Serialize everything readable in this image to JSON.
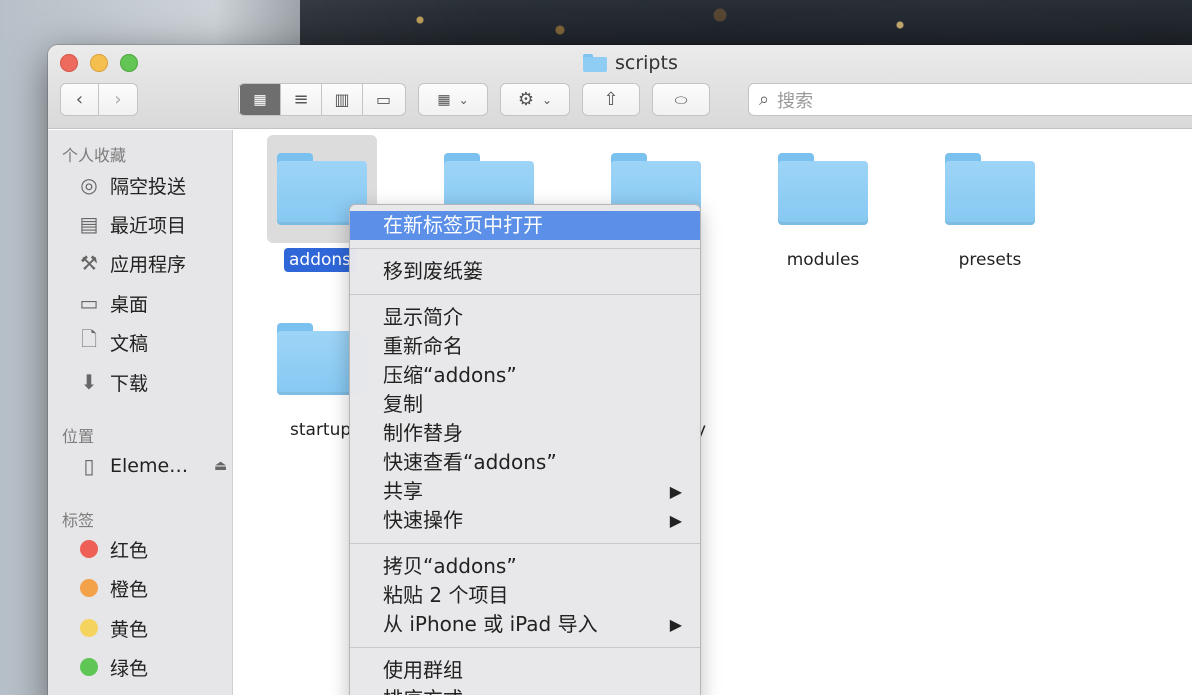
{
  "window": {
    "title": "scripts"
  },
  "toolbar": {
    "back_icon": "chevron-left-icon",
    "forward_icon": "chevron-right-icon",
    "view_buttons": [
      "icon-view",
      "list-view",
      "column-view",
      "gallery-view"
    ],
    "search_placeholder": "搜索"
  },
  "sidebar": {
    "favorites_header": "个人收藏",
    "favorites": [
      {
        "label": "隔空投送",
        "icon": "airdrop-icon"
      },
      {
        "label": "最近项目",
        "icon": "recents-icon"
      },
      {
        "label": "应用程序",
        "icon": "applications-icon"
      },
      {
        "label": "桌面",
        "icon": "desktop-icon"
      },
      {
        "label": "文稿",
        "icon": "documents-icon"
      },
      {
        "label": "下载",
        "icon": "downloads-icon"
      }
    ],
    "locations_header": "位置",
    "locations": [
      {
        "label": "Eleme…",
        "icon": "drive-icon"
      }
    ],
    "tags_header": "标签",
    "tags": [
      {
        "label": "红色",
        "color": "#ed5f57"
      },
      {
        "label": "橙色",
        "color": "#f3a24a"
      },
      {
        "label": "黄色",
        "color": "#f4d35e"
      },
      {
        "label": "绿色",
        "color": "#5fc656"
      }
    ]
  },
  "files": [
    {
      "name": "addons",
      "selected": true
    },
    {
      "name": "",
      "selected": false
    },
    {
      "name": "",
      "selected": false
    },
    {
      "name": "modules",
      "selected": false
    },
    {
      "name": "presets",
      "selected": false
    },
    {
      "name": "startup",
      "selected": false
    },
    {
      "name": "y",
      "selected": false
    }
  ],
  "context_menu": {
    "group1": [
      "在新标签页中打开"
    ],
    "group2": [
      "移到废纸篓"
    ],
    "group3": [
      "显示简介",
      "重新命名",
      "压缩“addons”",
      "复制",
      "制作替身",
      "快速查看“addons”",
      "共享",
      "快速操作"
    ],
    "group4": [
      "拷贝“addons”",
      "粘贴 2 个项目",
      "从 iPhone 或 iPad 导入"
    ],
    "group5": [
      "使用群组",
      "排序方式"
    ]
  }
}
